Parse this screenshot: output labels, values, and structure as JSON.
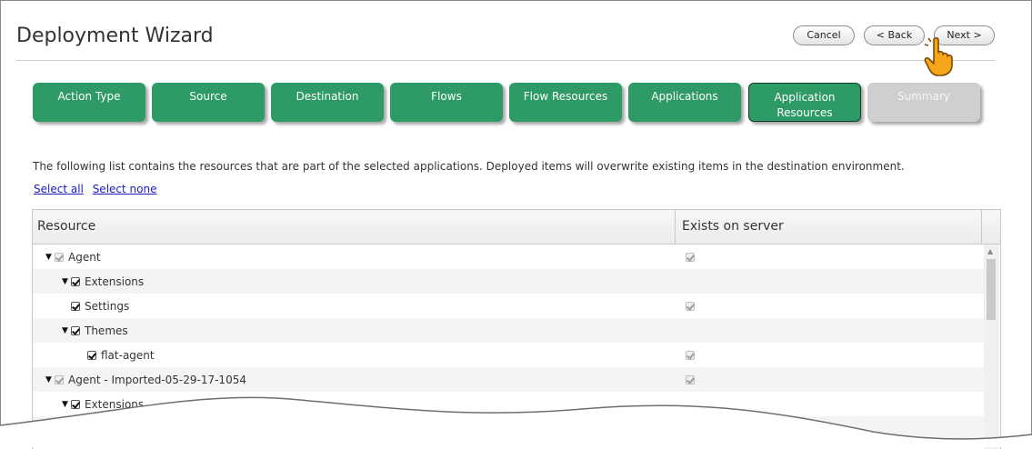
{
  "page_title": "Deployment Wizard",
  "header_buttons": {
    "cancel": "Cancel",
    "back": "< Back",
    "next": "Next >"
  },
  "steps": [
    {
      "label": "Action Type",
      "state": "done"
    },
    {
      "label": "Source",
      "state": "done"
    },
    {
      "label": "Destination",
      "state": "done"
    },
    {
      "label": "Flows",
      "state": "done"
    },
    {
      "label": "Flow Resources",
      "state": "done"
    },
    {
      "label": "Applications",
      "state": "done"
    },
    {
      "label": "Application Resources",
      "state": "active"
    },
    {
      "label": "Summary",
      "state": "disabled"
    }
  ],
  "description": "The following list contains the resources that are part of the selected applications. Deployed items will overwrite existing items in the destination environment.",
  "links": {
    "select_all": "Select all",
    "select_none": "Select none"
  },
  "table": {
    "columns": [
      "Resource",
      "Exists on server"
    ],
    "rows": [
      {
        "label": "Agent",
        "level": 0,
        "expander": true,
        "checked": true,
        "disabled": true,
        "exists": true
      },
      {
        "label": "Extensions",
        "level": 1,
        "expander": true,
        "checked": true,
        "disabled": false,
        "exists": false
      },
      {
        "label": "Settings",
        "level": 1,
        "expander": false,
        "checked": true,
        "disabled": false,
        "exists": true
      },
      {
        "label": "Themes",
        "level": 1,
        "expander": true,
        "checked": true,
        "disabled": false,
        "exists": false
      },
      {
        "label": "flat-agent",
        "level": 2,
        "expander": false,
        "checked": true,
        "disabled": false,
        "exists": true
      },
      {
        "label": "Agent - Imported-05-29-17-1054",
        "level": 0,
        "expander": true,
        "checked": true,
        "disabled": true,
        "exists": true
      },
      {
        "label": "Extensions",
        "level": 1,
        "expander": true,
        "checked": true,
        "disabled": false,
        "exists": false
      },
      {
        "label": "",
        "level": 1,
        "expander": false,
        "checked": false,
        "disabled": false,
        "exists": true
      }
    ]
  },
  "colors": {
    "step_green": "#2e9a66",
    "step_disabled": "#cfcfcf",
    "link_blue": "#1a1ac6",
    "cursor_orange": "#f5a61b"
  },
  "icons": {
    "cursor": "hand-pointer-icon",
    "expander": "triangle-down-icon",
    "checkbox": "checkbox-checked-icon"
  }
}
